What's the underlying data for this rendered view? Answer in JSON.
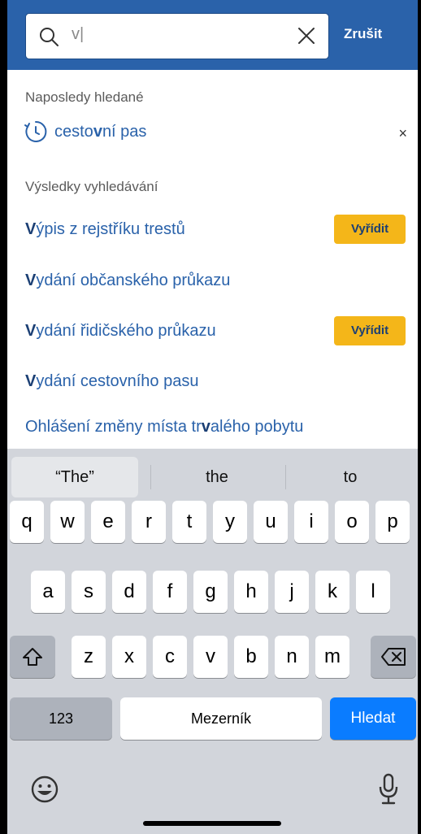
{
  "header": {
    "search_value": "v|",
    "cancel_label": "Zrušit"
  },
  "recent": {
    "label": "Naposledy hledané",
    "items": [
      {
        "text_pre": "cesto",
        "text_bold": "v",
        "text_post": "ní pas",
        "remove_glyph": "×"
      }
    ]
  },
  "results": {
    "label": "Výsledky vyhledávání",
    "items": [
      {
        "bold": "V",
        "rest": "ýpis z rejstříku trestů",
        "action": "Vyřídit"
      },
      {
        "bold": "V",
        "rest": "ydání občanského průkazu",
        "action": ""
      },
      {
        "bold": "V",
        "rest": "ydání řidičského průkazu",
        "action": "Vyřídit"
      },
      {
        "bold": "V",
        "rest": "ydání cestovního pasu",
        "action": ""
      },
      {
        "pre": "Ohlášení změny místa tr",
        "bold": "v",
        "rest": "alého pobytu",
        "action": ""
      }
    ]
  },
  "keyboard": {
    "suggestions": [
      "“The”",
      "the",
      "to"
    ],
    "row1": [
      "q",
      "w",
      "e",
      "r",
      "t",
      "y",
      "u",
      "i",
      "o",
      "p"
    ],
    "row2": [
      "a",
      "s",
      "d",
      "f",
      "g",
      "h",
      "j",
      "k",
      "l"
    ],
    "row3": [
      "z",
      "x",
      "c",
      "v",
      "b",
      "n",
      "m"
    ],
    "numbers_label": "123",
    "space_label": "Mezerník",
    "go_label": "Hledat"
  },
  "icons": {
    "search": "search-icon",
    "clear": "clear-icon",
    "clock": "clock-icon",
    "shift": "shift-icon",
    "backspace": "backspace-icon",
    "emoji": "emoji-icon",
    "mic": "microphone-icon"
  },
  "colors": {
    "header": "#2a62aa",
    "link": "#2a62aa",
    "accent_button": "#f4b619",
    "go_key": "#0a7cff"
  }
}
